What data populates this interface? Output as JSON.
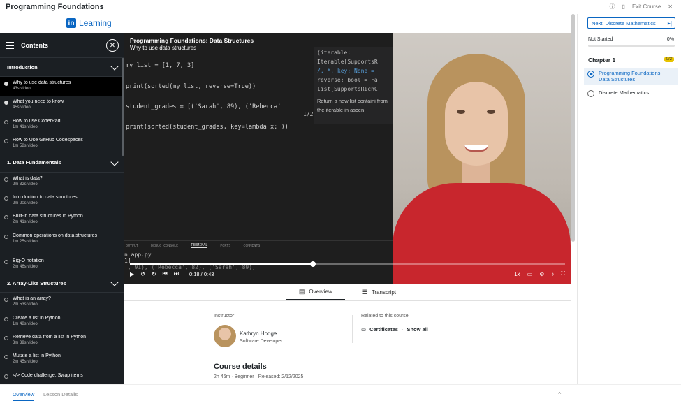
{
  "app": {
    "title": "Programming Foundations",
    "exit_label": "Exit Course",
    "logo_text": "Learning",
    "logo_badge": "in"
  },
  "sidebar": {
    "title": "Contents",
    "sections": [
      {
        "title": "Introduction",
        "lessons": [
          {
            "name": "Why to use data structures",
            "dur": "43s video",
            "state": "active"
          },
          {
            "name": "What you need to know",
            "dur": "45s video",
            "state": "done"
          },
          {
            "name": "How to use CoderPad",
            "dur": "1m 41s video",
            "state": "none"
          },
          {
            "name": "How to Use GitHub Codespaces",
            "dur": "1m 58s video",
            "state": "none"
          }
        ]
      },
      {
        "title": "1. Data Fundamentals",
        "lessons": [
          {
            "name": "What is data?",
            "dur": "2m 32s video"
          },
          {
            "name": "Introduction to data structures",
            "dur": "2m 20s video"
          },
          {
            "name": "Built-in data structures in Python",
            "dur": "2m 41s video"
          },
          {
            "name": "Common operations on data structures",
            "dur": "1m 25s video"
          },
          {
            "name": "Big-O notation",
            "dur": "2m 46s video"
          }
        ]
      },
      {
        "title": "2. Array-Like Structures",
        "lessons": [
          {
            "name": "What is an array?",
            "dur": "2m 53s video"
          },
          {
            "name": "Create a list in Python",
            "dur": "1m 48s video"
          },
          {
            "name": "Retrieve data from a list in Python",
            "dur": "3m 39s video"
          },
          {
            "name": "Mutate a list in Python",
            "dur": "2m 45s video"
          },
          {
            "name": "</> Code challenge: Swap items",
            "dur": ""
          }
        ]
      }
    ]
  },
  "video": {
    "title": "Programming Foundations: Data Structures",
    "subtitle": "Why to use data structures",
    "code_lines": [
      "my_list = [1, 7, 3]",
      "print(sorted(my_list, reverse=True))",
      "student_grades = [('Sarah', 89), ('Rebecca'",
      "print(sorted(student_grades, key=lambda x: ))"
    ],
    "tooltip_lines": [
      "(iterable:",
      "Iterable[SupportsR",
      "/, *, key: None =",
      "reverse: bool = Fa",
      "list[SupportsRichC"
    ],
    "tooltip_text": "Return a new list containi from the iterable in ascen",
    "page_count": "1/2",
    "panel_tabs": [
      "OUTPUT",
      "DEBUG CONSOLE",
      "TERMINAL",
      "PORTS",
      "COMMENTS"
    ],
    "terminal_lines": [
      "n app.py",
      "1]",
      "', 91), ('Rebecca', 82), ('Sarah', 89)]"
    ],
    "time": "0:18 / 0:43",
    "progress": 0.42,
    "speed": "1x"
  },
  "tabs": {
    "overview": "Overview",
    "transcript": "Transcript"
  },
  "overview": {
    "instructor_label": "Instructor",
    "instructor_name": "Kathryn Hodge",
    "instructor_role": "Software Developer",
    "related_label": "Related to this course",
    "certificates": "Certificates",
    "show_all": "Show all",
    "details_title": "Course details",
    "details_meta": "2h 46m · Beginner · Released: 2/12/2025"
  },
  "bottom_tabs": [
    "Overview",
    "Lesson Details"
  ],
  "right_panel": {
    "next_label": "Next: Discrete Mathematics",
    "status": "Not Started",
    "percent": "0%",
    "chapter": "Chapter 1",
    "chapter_badge": "0/2",
    "items": [
      {
        "label": "Programming Foundations: Data Structures",
        "active": true
      },
      {
        "label": "Discrete Mathematics",
        "active": false
      }
    ]
  },
  "colors": {
    "brand": "#0a66c2",
    "sidebar_bg": "#1b1f23",
    "badge": "#e7c300"
  }
}
